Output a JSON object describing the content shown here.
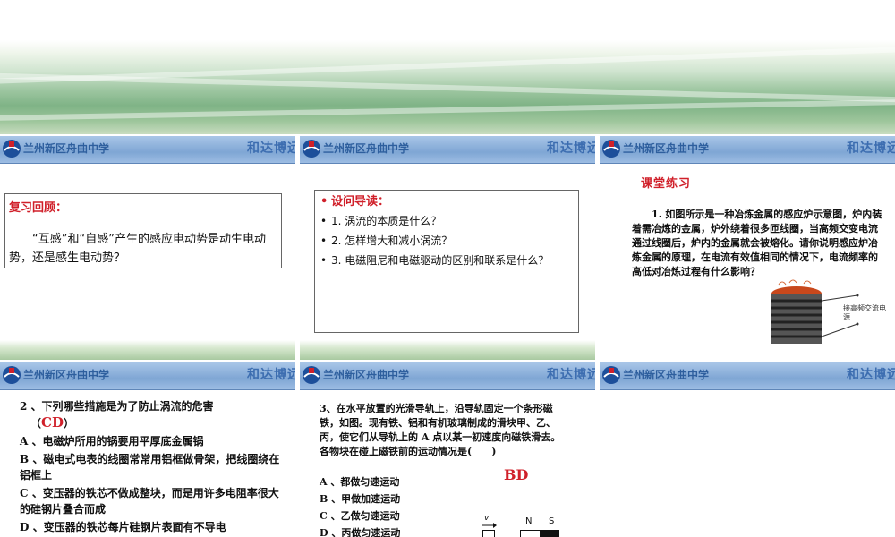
{
  "header": {
    "school": "兰州新区舟曲中学",
    "motto": "和达博远"
  },
  "slide1": {
    "heading": "复习回顾：",
    "body": "“互感”和“自感”产生的感应电动势是动生电动势，还是感生电动势？"
  },
  "slide2": {
    "title": "设问导读：",
    "items": [
      "1. 涡流的本质是什么？",
      "2. 怎样增大和减小涡流？",
      "3. 电磁阻尼和电磁驱动的区别和联系是什么？"
    ]
  },
  "slide3": {
    "heading": "课堂练习",
    "body": "1. 如图所示是一种冶炼金属的感应炉示意图，炉内装着需冶炼的金属，炉外绕着很多匝线圈，当高频交变电流通过线圈后，炉内的金属就会被熔化。请你说明感应炉冶炼金属的原理，在电流有效值相同的情况下，电流频率的高低对冶炼过程有什么影响？",
    "figure_label": "接高频交流电源"
  },
  "slide4": {
    "question": "2 、下列哪些措施是为了防止涡流的危害",
    "paren_open": "（",
    "answer": "CD",
    "paren_close": "）",
    "options": [
      "A 、电磁炉所用的锅要用平厚底金属锅",
      "B 、磁电式电表的线圈常常用铝框做骨架，把线圈绕在铝框上",
      "C 、变压器的铁芯不做成整块，而是用许多电阻率很大的硅钢片叠合而成",
      "D 、变压器的铁芯每片硅钢片表面有不导电"
    ]
  },
  "slide5": {
    "question": "3、在水平放置的光滑导轨上，沿导轨固定一个条形磁铁，如图。现有铁、铝和有机玻璃制成的滑块甲、乙、丙，使它们从导轨上的 A 点以某一初速度向磁铁滑去。各物块在碰上磁铁前的运动情况是(　　)",
    "answer": "BD",
    "options": [
      "A 、都做匀速运动",
      "B 、甲做加速运动",
      "C 、乙做匀速运动",
      "D 、丙做匀速运动"
    ],
    "figure": {
      "v": "v",
      "n": "N",
      "s": "S"
    }
  },
  "colors": {
    "accent_red": "#d0202a",
    "header_blue": "#7fa6d4"
  }
}
